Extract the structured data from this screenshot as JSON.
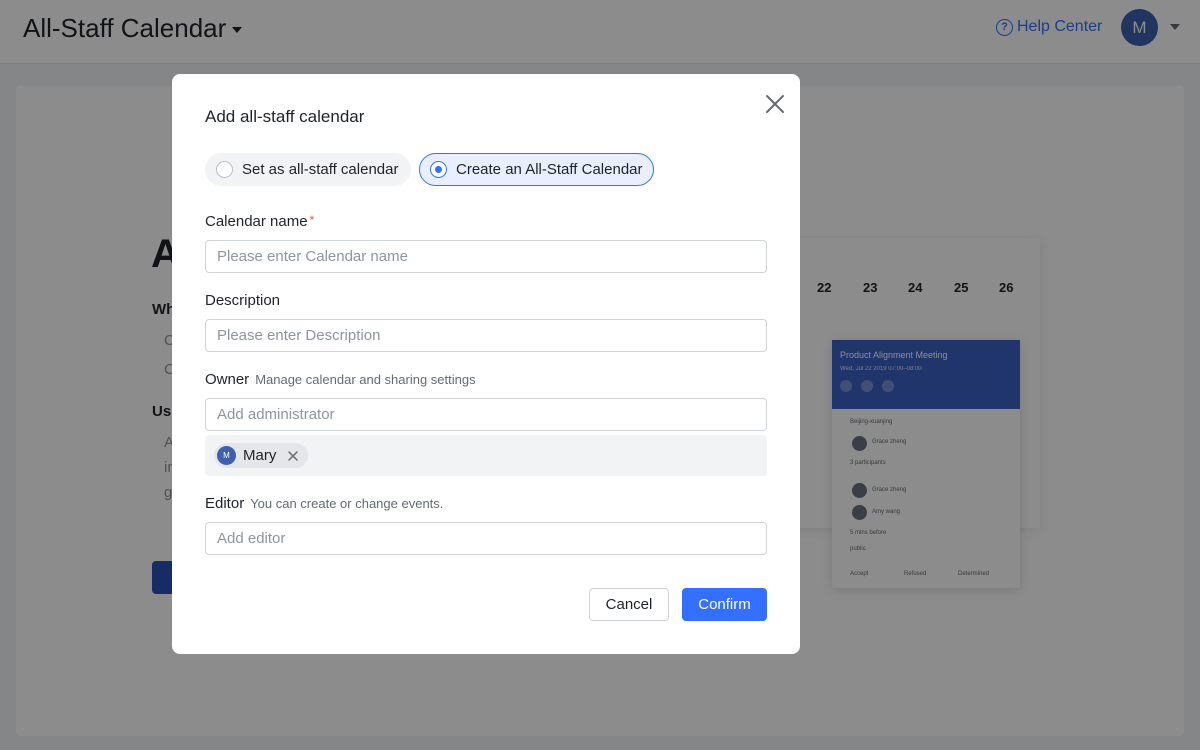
{
  "app": {
    "title": "All-Staff Calendar",
    "help_label": "Help Center",
    "help_icon_glyph": "?",
    "user_initial": "M"
  },
  "background": {
    "heading_partial": "A",
    "sub1_partial": "Wh",
    "sub2_partial": "Us",
    "bullets_partial": [
      "C",
      "C",
      "A",
      "in",
      "g"
    ],
    "preview_dates": [
      "22",
      "23",
      "24",
      "25",
      "26"
    ],
    "preview_popup": {
      "title": "Product Alignment Meeting",
      "time": "Wed, Jul 22 2019 07:00–08:00",
      "location": "Beijing-xuanjing",
      "organizer": "Grace zheng",
      "participants": "3 participants",
      "person_1": "Grace zheng",
      "person_2": "Amy wang",
      "reminder": "5 mins before",
      "visibility": "public",
      "responses": [
        "Accept",
        "Refused",
        "Determined"
      ]
    }
  },
  "modal": {
    "title": "Add all-staff calendar",
    "options": [
      {
        "label": "Set as all-staff calendar",
        "checked": false
      },
      {
        "label": "Create an All-Staff Calendar",
        "checked": true
      }
    ],
    "calendar_name": {
      "label": "Calendar name",
      "required_mark": "*",
      "placeholder": "Please enter Calendar name",
      "value": ""
    },
    "description": {
      "label": "Description",
      "placeholder": "Please enter Description",
      "value": ""
    },
    "owner": {
      "label": "Owner",
      "hint": "Manage calendar and sharing settings",
      "placeholder": "Add administrator",
      "chips": [
        {
          "name": "Mary",
          "initial": "M"
        }
      ]
    },
    "editor": {
      "label": "Editor",
      "hint": "You can create or change events.",
      "placeholder": "Add editor"
    },
    "cancel_label": "Cancel",
    "confirm_label": "Confirm"
  },
  "colors": {
    "accent": "#3370ff",
    "avatar": "#3f5faf",
    "required": "#f54a45"
  },
  "icons": {
    "close": "close-icon",
    "help": "help-circle-icon",
    "chip_remove": "remove-x-icon",
    "caret": "caret-down-icon"
  }
}
